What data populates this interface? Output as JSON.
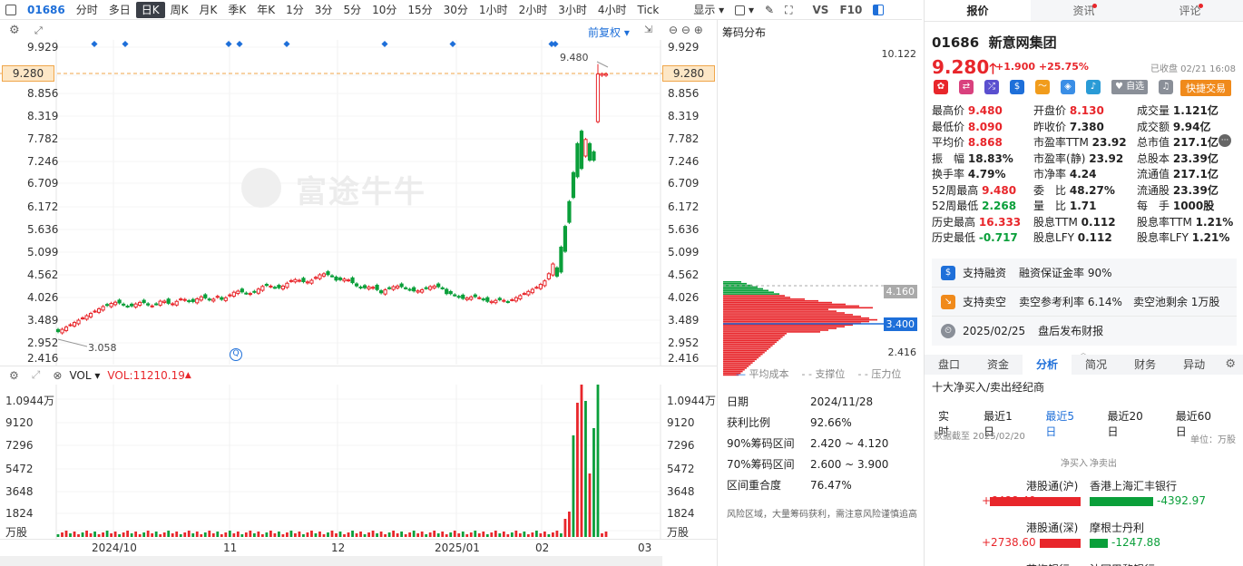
{
  "toolbar": {
    "symbol": "01686",
    "periods": [
      "分时",
      "多日",
      "日K",
      "周K",
      "月K",
      "季K",
      "年K",
      "1分",
      "3分",
      "5分",
      "10分",
      "15分",
      "30分",
      "1小时",
      "2小时",
      "3小时",
      "4小时",
      "Tick"
    ],
    "active_period": "日K",
    "display_label": "显示",
    "vs_label": "VS",
    "f10_label": "F10"
  },
  "price_chart": {
    "adjust_label": "前复权",
    "y_ticks": [
      "9.929",
      "9.280",
      "8.856",
      "8.319",
      "7.782",
      "7.246",
      "6.709",
      "6.172",
      "5.636",
      "5.099",
      "4.562",
      "4.026",
      "3.489",
      "2.952",
      "2.416"
    ],
    "current_price_tag": "9.280",
    "high_annotation": "9.480",
    "low_annotation": "3.058",
    "watermark": "富途牛牛",
    "x_labels": [
      "2024/10",
      "11",
      "12",
      "2025/01",
      "02",
      "03"
    ]
  },
  "volume_chart": {
    "indicator_label": "VOL",
    "vol_value": "VOL:11210.19",
    "y_ticks": [
      "1.0944万",
      "9120",
      "7296",
      "5472",
      "3648",
      "1824",
      "万股"
    ]
  },
  "chip_distribution": {
    "title": "筹码分布",
    "top_value": "10.122",
    "tag_high": "4.160",
    "tag_mid": "3.400",
    "bottom_value": "2.416",
    "legend": [
      "平均成本",
      "支撑位",
      "压力位"
    ],
    "info": [
      {
        "label": "日期",
        "value": "2024/11/28"
      },
      {
        "label": "获利比例",
        "value": "92.66%"
      },
      {
        "label": "90%筹码区间",
        "value": "2.420 ~ 4.120"
      },
      {
        "label": "70%筹码区间",
        "value": "2.600 ~ 3.900"
      },
      {
        "label": "区间重合度",
        "value": "76.47%"
      }
    ],
    "note": "风险区域，大量筹码获利，需注意风险谨慎追高"
  },
  "quote": {
    "tabs": [
      "报价",
      "资讯",
      "评论"
    ],
    "code": "01686",
    "name": "新意网集团",
    "price": "9.280",
    "change": "+1.900",
    "change_pct": "+25.75%",
    "status": "已收盘 02/21 16:08",
    "watch_label": "自选",
    "trade_label": "快捷交易",
    "fields": [
      [
        {
          "k": "最高价",
          "v": "9.480",
          "c": "red"
        },
        {
          "k": "开盘价",
          "v": "8.130",
          "c": "red"
        },
        {
          "k": "成交量",
          "v": "1.121亿",
          "c": ""
        }
      ],
      [
        {
          "k": "最低价",
          "v": "8.090",
          "c": "red"
        },
        {
          "k": "昨收价",
          "v": "7.380",
          "c": ""
        },
        {
          "k": "成交额",
          "v": "9.94亿",
          "c": ""
        }
      ],
      [
        {
          "k": "平均价",
          "v": "8.868",
          "c": "red"
        },
        {
          "k": "市盈率TTM",
          "v": "23.92",
          "c": ""
        },
        {
          "k": "总市值",
          "v": "217.1亿",
          "c": ""
        }
      ],
      [
        {
          "k": "振　幅",
          "v": "18.83%",
          "c": ""
        },
        {
          "k": "市盈率(静)",
          "v": "23.92",
          "c": ""
        },
        {
          "k": "总股本",
          "v": "23.39亿",
          "c": ""
        }
      ],
      [
        {
          "k": "换手率",
          "v": "4.79%",
          "c": ""
        },
        {
          "k": "市净率",
          "v": "4.24",
          "c": ""
        },
        {
          "k": "流通值",
          "v": "217.1亿",
          "c": ""
        }
      ],
      [
        {
          "k": "52周最高",
          "v": "9.480",
          "c": "red"
        },
        {
          "k": "委　比",
          "v": "48.27%",
          "c": ""
        },
        {
          "k": "流通股",
          "v": "23.39亿",
          "c": ""
        }
      ],
      [
        {
          "k": "52周最低",
          "v": "2.268",
          "c": "green"
        },
        {
          "k": "量　比",
          "v": "1.71",
          "c": ""
        },
        {
          "k": "每　手",
          "v": "1000股",
          "c": ""
        }
      ],
      [
        {
          "k": "历史最高",
          "v": "16.333",
          "c": "red"
        },
        {
          "k": "股息TTM",
          "v": "0.112",
          "c": ""
        },
        {
          "k": "股息率TTM",
          "v": "1.21%",
          "c": ""
        }
      ],
      [
        {
          "k": "历史最低",
          "v": "-0.717",
          "c": "green"
        },
        {
          "k": "股息LFY",
          "v": "0.112",
          "c": ""
        },
        {
          "k": "股息率LFY",
          "v": "1.21%",
          "c": ""
        }
      ]
    ],
    "features": [
      {
        "a": "支持融资",
        "b": "融资保证金率 90%"
      },
      {
        "a": "支持卖空",
        "b": "卖空参考利率 6.14%　卖空池剩余 1万股"
      },
      {
        "a": "2025/02/25",
        "b": "盘后发布财报"
      }
    ]
  },
  "analysis": {
    "tabs": [
      "盘口",
      "资金",
      "分析",
      "简况",
      "财务",
      "异动"
    ],
    "active": "分析",
    "title": "十大净买入/卖出经纪商",
    "ranges": [
      "实时",
      "最近1日",
      "最近5日",
      "最近20日",
      "最近60日"
    ],
    "active_range": "最近5日",
    "data_date": "数据截至 2025/02/20",
    "unit": "单位：万股",
    "col_buy": "净买入",
    "col_sell": "净卖出",
    "brokers": [
      {
        "buy_name": "港股通(沪)",
        "buy_val": "+6488.40",
        "sell_name": "香港上海汇丰银行",
        "sell_val": "-4392.97"
      },
      {
        "buy_name": "港股通(深)",
        "buy_val": "+2738.60",
        "sell_name": "摩根士丹利",
        "sell_val": "-1247.88"
      },
      {
        "buy_name": "花旗银行",
        "buy_val": "",
        "sell_name": "法国巴黎银行",
        "sell_val": ""
      }
    ]
  }
}
